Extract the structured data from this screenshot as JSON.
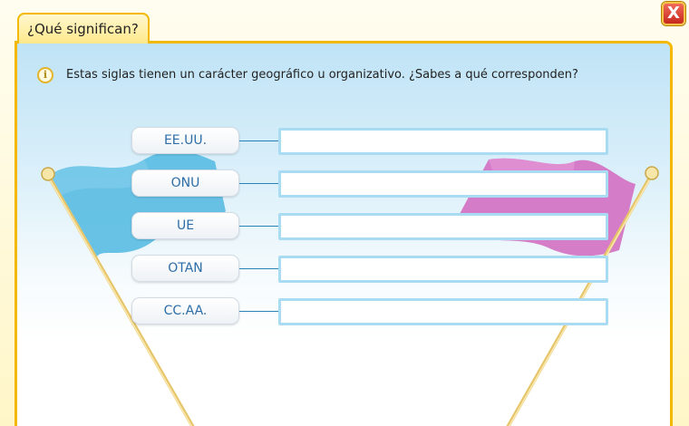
{
  "window": {
    "tab_title": "¿Qué significan?",
    "close_label": "X"
  },
  "instruction": {
    "icon_letter": "i",
    "text": "Estas siglas tienen un carácter geográfico u organizativo. ¿Sabes a qué corresponden?"
  },
  "acronyms": [
    {
      "label": "EE.UU.",
      "answer": ""
    },
    {
      "label": "ONU",
      "answer": ""
    },
    {
      "label": "UE",
      "answer": ""
    },
    {
      "label": "OTAN",
      "answer": ""
    },
    {
      "label": "CC.AA.",
      "answer": ""
    }
  ],
  "colors": {
    "frame_border": "#f5b800",
    "chip_text": "#2e6ea7",
    "input_border": "#a9dcf3",
    "left_flag": "#5bbde3",
    "right_flag": "#d36fc2",
    "close_button": "#d63b2c"
  }
}
